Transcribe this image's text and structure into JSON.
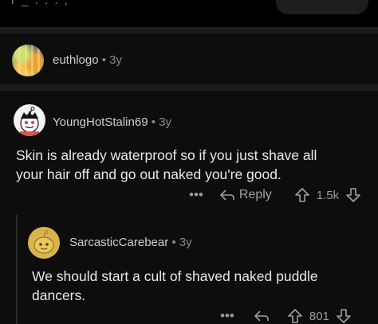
{
  "top": {
    "cut_text": "r  _    . . . ,"
  },
  "collapsed_comment": {
    "username": "euthlogo",
    "separator": "•",
    "age": "3y"
  },
  "parent_comment": {
    "username": "YoungHotStalin69",
    "separator": "•",
    "age": "3y",
    "body": "Skin is already waterproof so if you just shave all\nyour hair off and go out naked you're good.",
    "more": "•••",
    "reply_label": "Reply",
    "vote_count": "1.5k"
  },
  "reply_comment": {
    "username": "SarcasticCarebear",
    "separator": "•",
    "age": "3y",
    "body": "We should start a cult of shaved naked puddle\ndancers.",
    "more": "•••",
    "vote_count": "801"
  },
  "colors": {
    "background": "#000000",
    "card": "#0d0d0d",
    "separator": "#1b1b1b",
    "text_primary": "#e8e8e8",
    "text_muted": "#8a8a8a"
  },
  "icons": {
    "reply": "reply-arrow-icon",
    "upvote": "upvote-arrow-icon",
    "downvote": "downvote-arrow-icon",
    "more": "more-options-icon"
  }
}
